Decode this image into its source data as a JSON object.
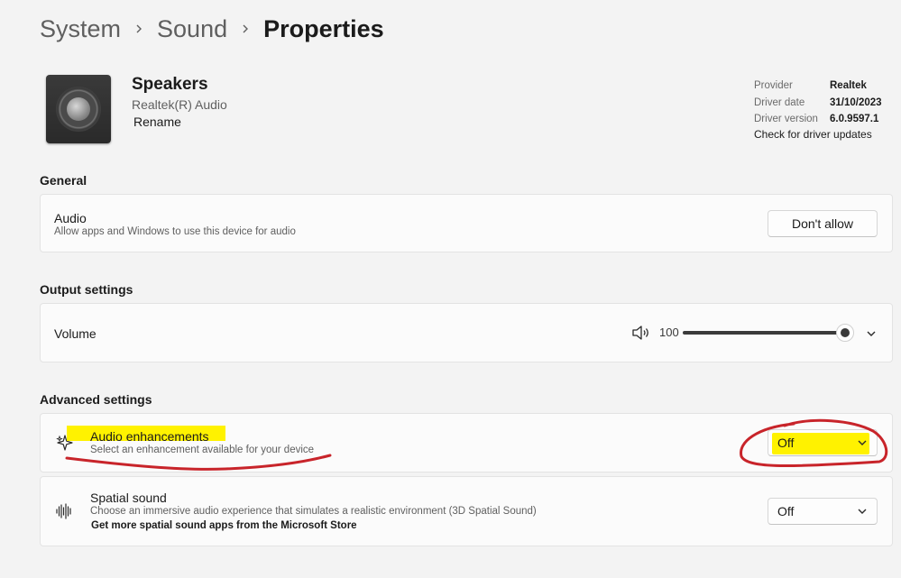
{
  "breadcrumb": {
    "items": [
      "System",
      "Sound",
      "Properties"
    ]
  },
  "device": {
    "name": "Speakers",
    "subtitle": "Realtek(R) Audio",
    "rename_label": "Rename",
    "icon": "speaker-device-icon"
  },
  "driver": {
    "rows": [
      {
        "key": "Provider",
        "value": "Realtek"
      },
      {
        "key": "Driver date",
        "value": "31/10/2023"
      },
      {
        "key": "Driver version",
        "value": "6.0.9597.1"
      }
    ],
    "update_label": "Check for driver updates"
  },
  "general": {
    "section_title": "General",
    "audio": {
      "title": "Audio",
      "description": "Allow apps and Windows to use this device for audio",
      "button_label": "Don't allow"
    }
  },
  "output": {
    "section_title": "Output settings",
    "volume": {
      "title": "Volume",
      "value": "100",
      "level_percent": 100,
      "icon": "speaker-volume-icon"
    }
  },
  "advanced": {
    "section_title": "Advanced settings",
    "enhancements": {
      "title": "Audio enhancements",
      "description": "Select an enhancement available for your device",
      "selected": "Off",
      "icon": "sparkle-icon"
    },
    "spatial": {
      "title": "Spatial sound",
      "description": "Choose an immersive audio experience that simulates a realistic environment (3D Spatial Sound)",
      "store_link": "Get more spatial sound apps from the Microsoft Store",
      "selected": "Off",
      "icon": "sound-wave-icon"
    }
  },
  "annotation_colors": {
    "highlight": "#fff200",
    "pen": "#c8242a"
  }
}
